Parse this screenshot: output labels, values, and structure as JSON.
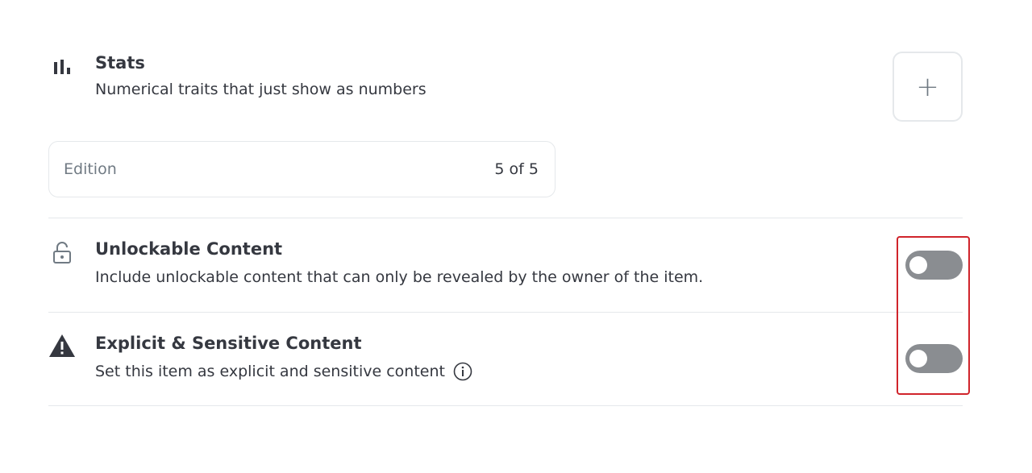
{
  "stats": {
    "icon": "bar-chart-icon",
    "title": "Stats",
    "description": "Numerical traits that just show as numbers",
    "add_button_label": "+",
    "items": [
      {
        "label": "Edition",
        "value": "5 of 5"
      }
    ]
  },
  "unlockable": {
    "icon": "lock-icon",
    "title": "Unlockable Content",
    "description": "Include unlockable content that can only be revealed by the owner of the item.",
    "enabled": false
  },
  "explicit": {
    "icon": "warning-icon",
    "title": "Explicit & Sensitive Content",
    "description": "Set this item as explicit and sensitive content",
    "info_icon": "info-icon",
    "enabled": false
  },
  "colors": {
    "text": "#353840",
    "muted": "#707a83",
    "border": "#e5e8eb",
    "toggle_off": "#8a8d91",
    "highlight": "#d0242b"
  }
}
